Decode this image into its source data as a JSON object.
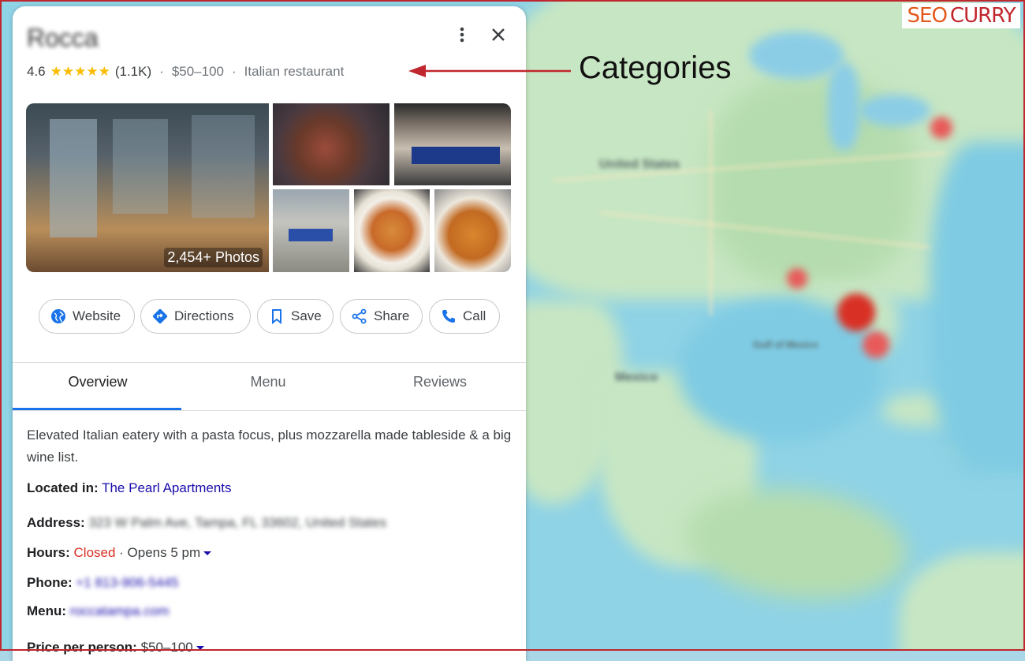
{
  "place": {
    "name": "Rocca",
    "rating": "4.6",
    "stars": "★★★★★",
    "review_count": "(1.1K)",
    "price": "$50–100",
    "category": "Italian restaurant"
  },
  "photos": {
    "count_label": "2,454+ Photos"
  },
  "actions": {
    "website": "Website",
    "directions": "Directions",
    "save": "Save",
    "share": "Share",
    "call": "Call"
  },
  "tabs": {
    "overview": "Overview",
    "menu": "Menu",
    "reviews": "Reviews"
  },
  "overview": {
    "description": "Elevated Italian eatery with a pasta focus, plus mozzarella made tableside & a big wine list.",
    "located_in_label": "Located in:",
    "located_in_value": "The Pearl Apartments",
    "address_label": "Address:",
    "address_value": "323 W Palm Ave, Tampa, FL 33602, United States",
    "hours_label": "Hours:",
    "hours_status": "Closed",
    "hours_next": " · Opens 5 pm",
    "phone_label": "Phone:",
    "phone_value": "+1 813-906-5445",
    "menu_label": "Menu:",
    "menu_value": "roccatampa.com",
    "price_label": "Price per person:",
    "price_value": "$50–100"
  },
  "annotation": {
    "label": "Categories"
  },
  "brand": {
    "seo": "SEO",
    "curry": "CURRY"
  },
  "map": {
    "labels": [
      "United States",
      "Gulf of Mexico",
      "Mexico"
    ]
  },
  "colors": {
    "accent": "#1a73e8",
    "link": "#1a0dab",
    "closed": "#d93025",
    "star": "#fbbc04",
    "frame": "#c0262d"
  }
}
